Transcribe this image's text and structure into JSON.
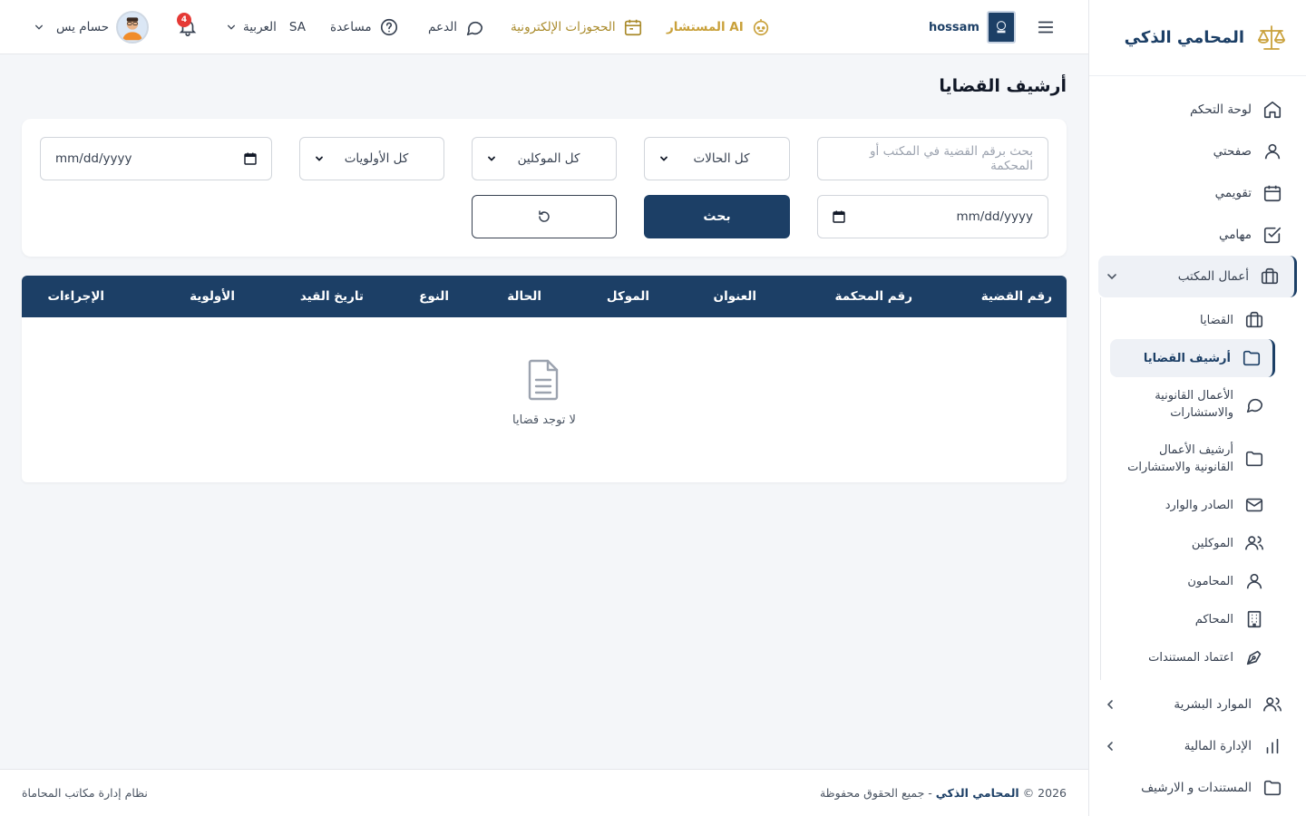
{
  "brand": {
    "name": "المحامي الذكي"
  },
  "topbar": {
    "firm_name": "hossam",
    "ai_advisor": "المستشار AI",
    "bookings": "الحجوزات الإلكترونية",
    "support": "الدعم",
    "help": "مساعدة",
    "language": "العربية",
    "language_code": "SA",
    "notifications_count": "4",
    "user_name": "حسام يس"
  },
  "sidebar": {
    "dashboard": "لوحة التحكم",
    "my_page": "صفحتي",
    "calendar": "تقويمي",
    "tasks": "مهامي",
    "office_work": "أعمال المكتب",
    "sub": {
      "cases": "القضايا",
      "cases_archive": "أرشيف القضايا",
      "legal_work_1": "الأعمال القانونية",
      "legal_work_2": "والاستشارات",
      "legal_archive_1": "أرشيف الأعمال",
      "legal_archive_2": "القانونية والاستشارات",
      "mail": "الصادر والوارد",
      "clients": "الموكلين",
      "lawyers": "المحامون",
      "courts": "المحاكم",
      "doc_approval": "اعتماد المستندات"
    },
    "hr": "الموارد البشرية",
    "finance": "الإدارة المالية",
    "documents": "المستندات و الارشيف"
  },
  "page": {
    "title": "أرشيف القضايا",
    "search_placeholder": "بحث برقم القضية في المكتب أو المحكمة",
    "date_placeholder": "mm/dd/yyyy",
    "status_select": "كل الحالات",
    "client_select": "كل الموكلين",
    "priority_select": "كل الأولويات",
    "search_button": "بحث"
  },
  "table": {
    "columns": [
      "رقم القضية",
      "رقم المحكمة",
      "العنوان",
      "الموكل",
      "الحالة",
      "النوع",
      "تاريخ القيد",
      "الأولوية",
      "الإجراءات"
    ],
    "empty_text": "لا توجد قضايا"
  },
  "footer": {
    "copyright_prefix": "© 2026",
    "brand": "المحامي الذكي",
    "rights": "- جميع الحقوق محفوظة",
    "system": "نظام إدارة مكاتب المحاماة"
  },
  "colors": {
    "primary": "#1c3f66",
    "accent": "#c9a13b",
    "danger": "#e53935"
  }
}
